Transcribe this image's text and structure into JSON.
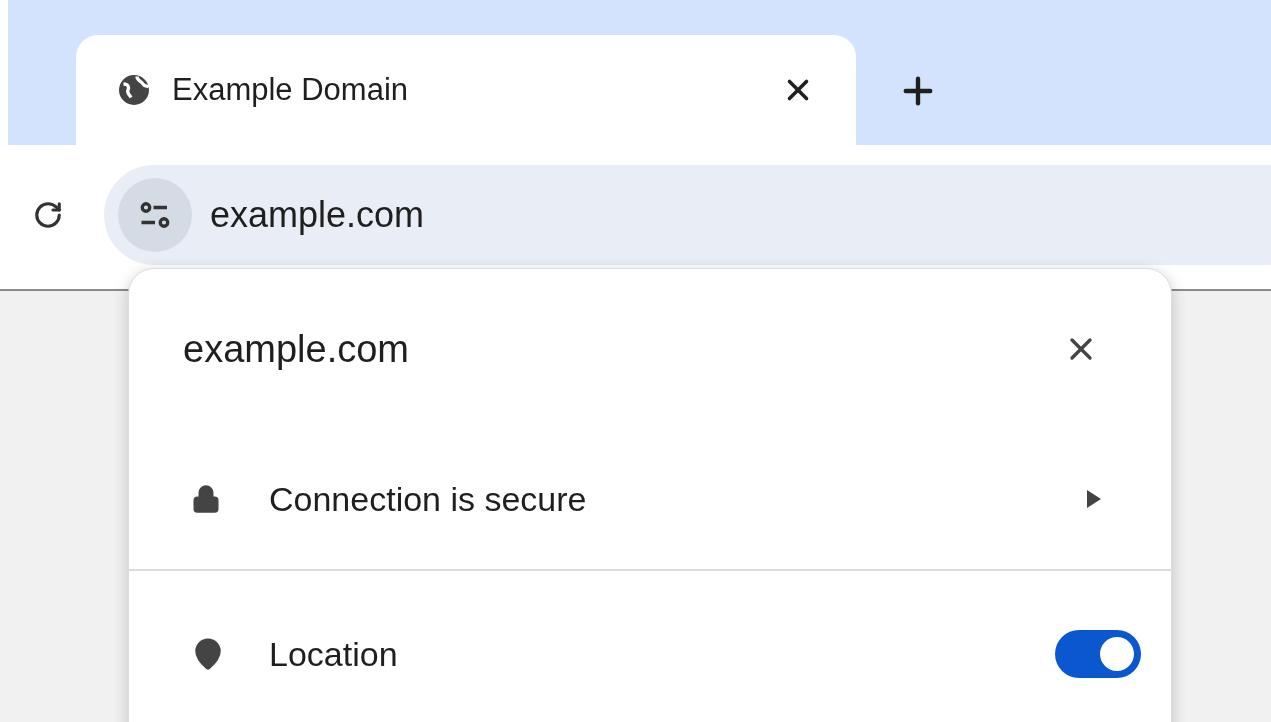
{
  "tab": {
    "title": "Example Domain",
    "selected": true
  },
  "omnibox": {
    "url": "example.com"
  },
  "popup": {
    "title": "example.com",
    "rows": [
      {
        "kind": "link",
        "label": "Connection is secure"
      },
      {
        "kind": "toggle",
        "label": "Location",
        "on": true
      }
    ]
  }
}
